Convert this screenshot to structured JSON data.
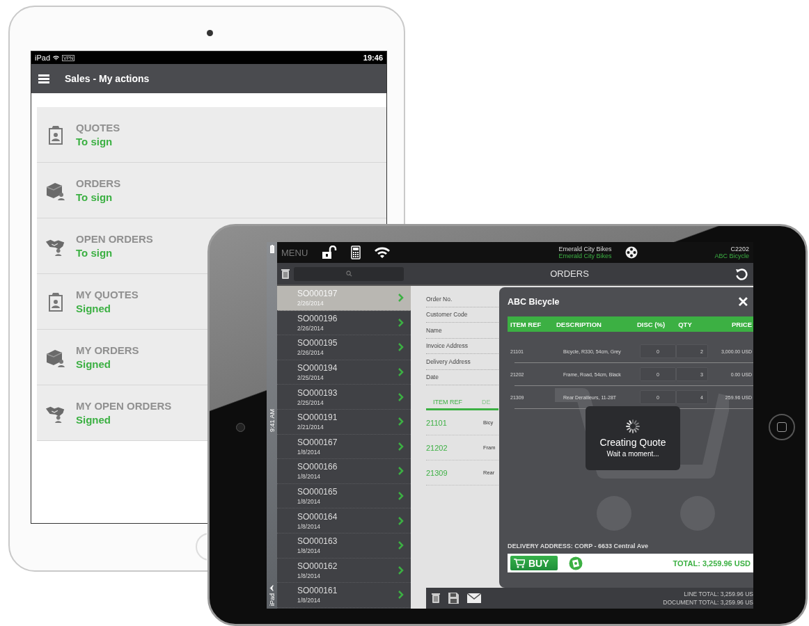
{
  "portrait_tablet": {
    "status_bar": {
      "device": "iPad",
      "vpn": "VPN",
      "time": "19:46"
    },
    "header": {
      "title": "Sales - My actions"
    },
    "actions": [
      {
        "kind": "clipboard",
        "title": "QUOTES",
        "status": "To sign"
      },
      {
        "kind": "box",
        "title": "ORDERS",
        "status": "To sign"
      },
      {
        "kind": "handshake",
        "title": "OPEN ORDERS",
        "status": "To sign"
      },
      {
        "kind": "clipboard",
        "title": "MY QUOTES",
        "status": "Signed"
      },
      {
        "kind": "box",
        "title": "MY ORDERS",
        "status": "Signed"
      },
      {
        "kind": "handshake",
        "title": "MY OPEN ORDERS",
        "status": "Signed"
      }
    ]
  },
  "landscape_tablet": {
    "status_bar": {
      "time": "9:41 AM",
      "device": "iPad"
    },
    "top_bar": {
      "menu": "MENU",
      "company": "Emerald City Bikes",
      "company_sub": "Emerald City Bikes",
      "customer_code": "C2202",
      "customer_name": "ABC Bicycle"
    },
    "toolbar": {
      "title": "ORDERS"
    },
    "orders": [
      {
        "number": "SO000197",
        "date": "2/26/2014",
        "selected": true
      },
      {
        "number": "SO000196",
        "date": "2/26/2014",
        "selected": false
      },
      {
        "number": "SO000195",
        "date": "2/26/2014",
        "selected": false
      },
      {
        "number": "SO000194",
        "date": "2/25/2014",
        "selected": false
      },
      {
        "number": "SO000193",
        "date": "2/25/2014",
        "selected": false
      },
      {
        "number": "SO000191",
        "date": "2/21/2014",
        "selected": false
      },
      {
        "number": "SO000167",
        "date": "1/8/2014",
        "selected": false
      },
      {
        "number": "SO000166",
        "date": "1/8/2014",
        "selected": false
      },
      {
        "number": "SO000165",
        "date": "1/8/2014",
        "selected": false
      },
      {
        "number": "SO000164",
        "date": "1/8/2014",
        "selected": false
      },
      {
        "number": "SO000163",
        "date": "1/8/2014",
        "selected": false
      },
      {
        "number": "SO000162",
        "date": "1/8/2014",
        "selected": false
      },
      {
        "number": "SO000161",
        "date": "1/8/2014",
        "selected": false
      }
    ],
    "order_form": {
      "fields": [
        "Order No.",
        "Customer Code",
        "Name",
        "Invoice Address",
        "Delivery Address",
        "Date"
      ]
    },
    "line_tabs": [
      {
        "label": "ITEM REF",
        "selected": true
      },
      {
        "label": "DE",
        "selected": false
      }
    ],
    "lines": [
      {
        "ref": "21101",
        "description": "Bicy"
      },
      {
        "ref": "21202",
        "description": "Fram"
      },
      {
        "ref": "21309",
        "description": "Rear"
      }
    ],
    "footer": {
      "line_total": "LINE TOTAL: 3,259.96 US",
      "document_total": "DOCUMENT TOTAL: 3,259.96 US"
    },
    "quote_dialog": {
      "title": "ABC Bicycle",
      "close": "✕",
      "columns": [
        "ITEM REF",
        "DESCRIPTION",
        "DISC (%)",
        "QTY",
        "PRICE"
      ],
      "rows": [
        {
          "ref": "21101",
          "description": "Bicycle, R330, 54cm, Grey",
          "disc": "0",
          "qty": "2",
          "price": "3,000.00 USD"
        },
        {
          "ref": "21202",
          "description": "Frame, Road, 54cm, Black",
          "disc": "0",
          "qty": "3",
          "price": "0.00 USD"
        },
        {
          "ref": "21309",
          "description": "Rear Derailleurs, 11-28T",
          "disc": "0",
          "qty": "4",
          "price": "259.96 USD"
        }
      ],
      "loading": {
        "title": "Creating Quote",
        "message": "Wait a moment..."
      },
      "delivery_address": "DELIVERY ADDRESS: CORP - 6633 Central Ave",
      "buy": "BUY",
      "total": "TOTAL: 3,259.96 USD"
    }
  }
}
